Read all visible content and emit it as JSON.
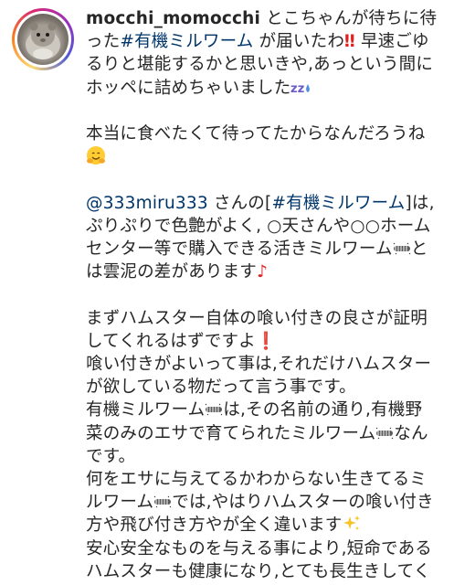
{
  "post": {
    "username": "mocchi_momocchi",
    "avatar_icon": "hamster-avatar-icon",
    "intro_before_tag": " とこちゃんが待ちに待った",
    "tag_main": "#有機ミルワーム",
    "intro_after_tag": " が届いたわ",
    "intro_after_excl": " 早速ごゆるりと堪能するかと思いきや,あっという間にホッペに詰めちゃいました",
    "para2": "本当に食べたくて待ってたからなんだろうね",
    "mention": "@333miru333",
    "para3_a": " さんの[",
    "para3_tag": "#有機ミルワーム",
    "para3_b": "]は,ぷりぷりで色艶がよく, ○天さんや○○ホームセンター等で購入できる活きミルワーム",
    "para3_c": "とは雲泥の差があります",
    "para4_a": "まずハムスター自体の喰い付きの良さが証明してくれるはずですよ",
    "para4_b": "喰い付きがよいって事は,それだけハムスターが欲している物だって言う事です。",
    "para4_c1": "有機ミルワーム",
    "para4_c2": "は,その名前の通り,有機野菜のみのエサで育てられたミルワーム",
    "para4_c3": "なんです。",
    "para4_d1": "何をエサに与えてるかわからない生きてるミルワーム",
    "para4_d2": "では,やはりハムスターの喰い付き方や飛び付き方やが全く違います",
    "para4_e": "安心安全なものを与える事により,短命であるハムスターも健康になり,とても長生きしてくれます"
  },
  "colors": {
    "text": "#262626",
    "hashtag": "#003569",
    "exclamation": "#e0201f"
  },
  "icons": [
    "double-exclamation-icon",
    "sleeping-icon",
    "hugging-face-icon",
    "worm-icon",
    "musical-note-icon",
    "exclamation-icon",
    "sparkles-icon",
    "smiling-face-icon"
  ]
}
